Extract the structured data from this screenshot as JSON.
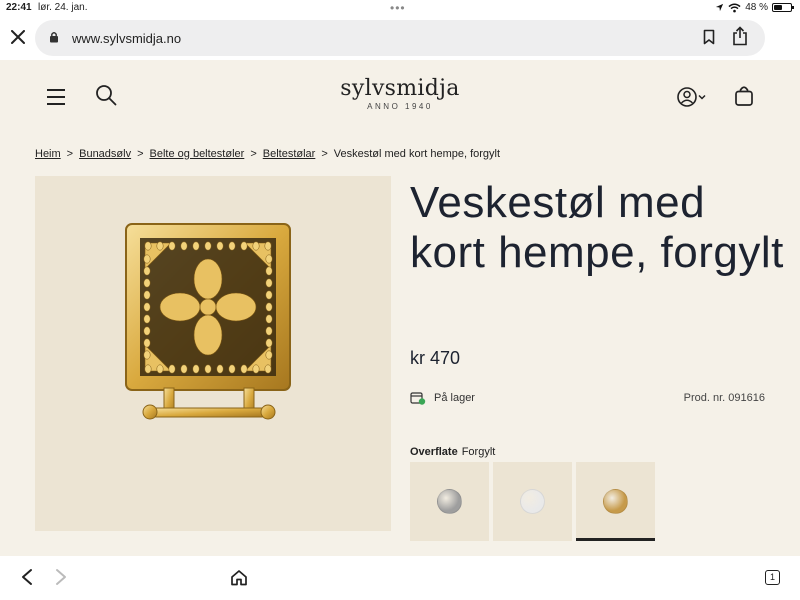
{
  "status": {
    "time": "22:41",
    "date": "lør. 24. jan.",
    "battery_text": "48 %",
    "battery_level": 0.48,
    "icons": [
      "location-icon",
      "wifi-icon",
      "battery-icon"
    ]
  },
  "browser": {
    "url": "www.sylvsmidja.no",
    "icons": [
      "close-icon",
      "lock-icon",
      "bookmark-icon",
      "share-icon"
    ]
  },
  "header": {
    "logo_name": "sylvsmidja",
    "logo_sub": "ANNO 1940",
    "icons": [
      "menu-icon",
      "search-icon",
      "user-icon",
      "cart-icon"
    ]
  },
  "breadcrumb": {
    "items": [
      "Heim",
      "Bunadsølv",
      "Belte og beltestøler",
      "Beltestølar"
    ],
    "current": "Veskestøl med kort hempe, forgylt",
    "separator": ">"
  },
  "product": {
    "title": "Veskestøl med kort hempe, forgylt",
    "price": "kr 470",
    "stock": "På lager",
    "prod_nr": "Prod. nr. 091616",
    "finish_label": "Overflate",
    "finish_value": "Forgylt",
    "swatches": [
      {
        "name": "silver-oxidized",
        "color": "#9e9e9e",
        "selected": false
      },
      {
        "name": "silver-white",
        "color": "#e9e9e9",
        "selected": false
      },
      {
        "name": "gold",
        "color": "#c69a4a",
        "selected": true
      }
    ]
  },
  "toolbar": {
    "tab_count": "1",
    "icons": [
      "back-icon",
      "forward-icon",
      "home-icon",
      "tabs-icon"
    ]
  },
  "colors": {
    "page_bg": "#f5f1e8",
    "image_bg": "#ece4d3",
    "title_text": "#1d2330",
    "stock_green": "#3aa655"
  }
}
